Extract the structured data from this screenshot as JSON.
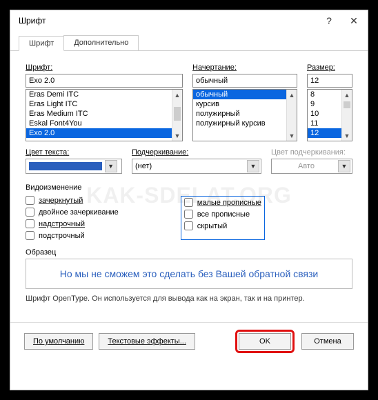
{
  "window": {
    "title": "Шрифт",
    "help_icon": "?",
    "close_icon": "✕"
  },
  "tabs": {
    "font": "Шрифт",
    "advanced": "Дополнительно"
  },
  "labels": {
    "font": "Шрифт:",
    "style": "Начертание:",
    "size": "Размер:",
    "text_color": "Цвет текста:",
    "underline_style": "Подчеркивание:",
    "underline_color": "Цвет подчеркивания:",
    "effects": "Видоизменение",
    "preview": "Образец"
  },
  "font_input": "Exo 2.0",
  "font_list": [
    "Eras Demi ITC",
    "Eras Light ITC",
    "Eras Medium ITC",
    "Eskal Font4You",
    "Exo 2.0"
  ],
  "font_selected_index": 4,
  "style_input": "обычный",
  "style_list": [
    "обычный",
    "курсив",
    "полужирный",
    "полужирный курсив"
  ],
  "style_selected_index": 0,
  "size_input": "12",
  "size_list": [
    "8",
    "9",
    "10",
    "11",
    "12"
  ],
  "size_selected_index": 4,
  "underline_value": "(нет)",
  "underline_color_value": "Авто",
  "effects_left": [
    "зачеркнутый",
    "двойное зачеркивание",
    "надстрочный",
    "подстрочный"
  ],
  "effects_right": [
    "малые прописные",
    "все прописные",
    "скрытый"
  ],
  "preview_text": "Но мы не сможем это сделать без Вашей обратной связи",
  "description": "Шрифт OpenType. Он используется для вывода как на экран, так и на принтер.",
  "buttons": {
    "default": "По умолчанию",
    "text_effects": "Текстовые эффекты...",
    "ok": "OK",
    "cancel": "Отмена"
  },
  "watermark": "KAK-SDELAT.ORG"
}
